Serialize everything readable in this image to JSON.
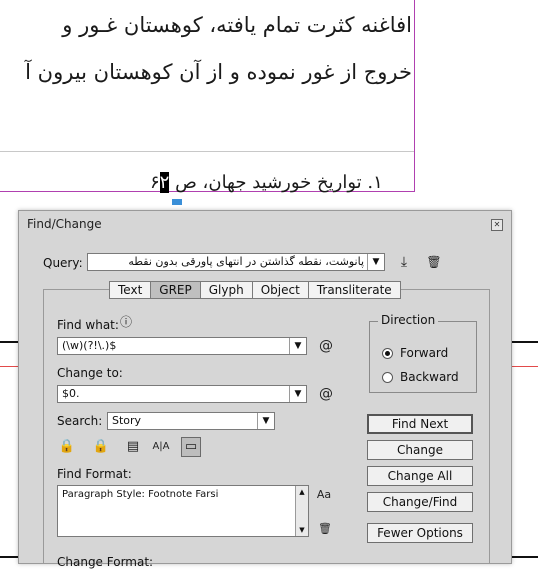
{
  "document": {
    "line1": "افاغنه کثرت تمام یافته، کوهستان غـور و",
    "line2": "خروج از غور نموده و از آن کوهستان بیرون آ",
    "footnote_before": "۱. تواریخ خورشید جهان، ص ۶",
    "footnote_highlight": "۲"
  },
  "dialog": {
    "title": "Find/Change",
    "query_label": "Query:",
    "query_value": "پانوشت، نقطه گذاشتن در انتهای پاورقی بدون نقطه",
    "tabs": [
      "Text",
      "GREP",
      "Glyph",
      "Object",
      "Transliterate"
    ],
    "active_tab": "GREP",
    "find_what_label": "Find what:",
    "find_what_value": "(\\w)(?!\\.)$",
    "change_to_label": "Change to:",
    "change_to_value": "$0.",
    "search_label": "Search:",
    "search_value": "Story",
    "find_format_label": "Find Format:",
    "find_format_value": "Paragraph Style: Footnote Farsi",
    "change_format_label": "Change Format:",
    "direction": {
      "legend": "Direction",
      "options": [
        "Forward",
        "Backward"
      ],
      "selected": "Forward"
    },
    "buttons": {
      "find_next": "Find Next",
      "change": "Change",
      "change_all": "Change All",
      "change_find": "Change/Find",
      "fewer_options": "Fewer Options"
    },
    "icons": {
      "close": "✕",
      "save_query": "⤓",
      "delete_query": "🗑",
      "info": "ⓘ",
      "special_chars": "@",
      "format_search": "Aa",
      "trash": "🗑",
      "include_locked_layers": "🔒",
      "include_locked_stories": "🔒",
      "include_hidden_layers": "▤",
      "include_master_pages": "A|A",
      "include_footnotes": "▭"
    }
  }
}
